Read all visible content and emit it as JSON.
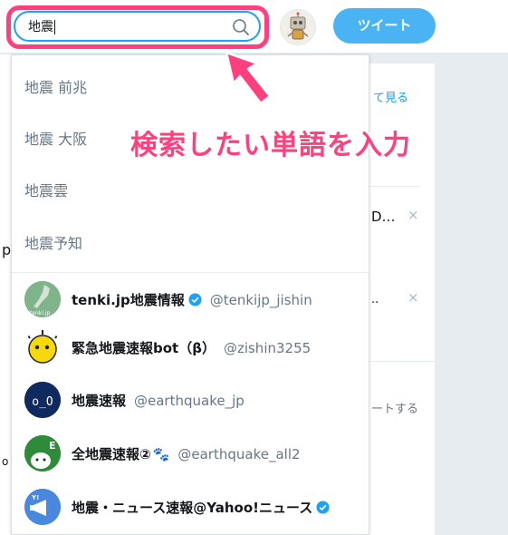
{
  "search": {
    "query": "地震"
  },
  "header": {
    "tweet_button": "ツイート"
  },
  "suggestions": [
    "地震 前兆",
    "地震 大阪",
    "地震雲",
    "地震予知"
  ],
  "users": [
    {
      "name": "tenki.jp地震情報",
      "handle": "@tenkijp_jishin",
      "verified": true,
      "avatar_text": "tenki.jp"
    },
    {
      "name": "緊急地震速報bot（β）",
      "handle": "@zishin3255",
      "verified": false
    },
    {
      "name": "地震速報",
      "handle": "@earthquake_jp",
      "verified": false,
      "avatar_text": "o_O"
    },
    {
      "name": "全地震速報②",
      "handle": "@earthquake_all2",
      "verified": false,
      "suffix": "🐾",
      "avatar_text": "E"
    },
    {
      "name": "地震・ニュース速報@Yahoo!ニュース",
      "handle": "",
      "verified": true,
      "avatar_text": "Y!"
    }
  ],
  "background": {
    "see_more": "て見る",
    "trend_snippet": "D…",
    "retweet_snippet": "ートする",
    "left_p": "p",
    "left_dot": "o"
  },
  "annotation": {
    "text": "検索したい単語を入力",
    "color": "#ff3f7e"
  },
  "colors": {
    "accent": "#1da1f2",
    "tweet_button": "#4ab3f4",
    "highlight": "#ff3f7e"
  }
}
